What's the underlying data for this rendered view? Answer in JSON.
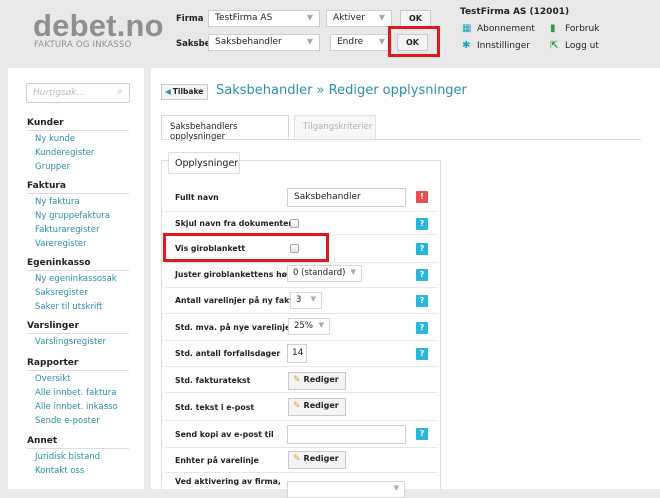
{
  "brand": {
    "name": "debet.no",
    "tagline": "FAKTURA OG INKASSO"
  },
  "topbar": {
    "firma_label": "Firma",
    "firma_value": "TestFirma AS",
    "firma_action": "Aktiver",
    "saksbeh_label": "Saksbeh.",
    "saksbeh_value": "Saksbehandler",
    "saksbeh_action": "Endre",
    "ok_label": "OK",
    "company": "TestFirma AS (12001)",
    "links": {
      "abonnement": "Abonnement",
      "forbruk": "Forbruk",
      "innstillinger": "Innstillinger",
      "loggut": "Logg ut"
    }
  },
  "sidebar": {
    "search_placeholder": "Hurtigsøk...",
    "sections": [
      {
        "title": "Kunder",
        "items": [
          "Ny kunde",
          "Kunderegister",
          "Grupper"
        ]
      },
      {
        "title": "Faktura",
        "items": [
          "Ny faktura",
          "Ny gruppefaktura",
          "Fakturaregister",
          "Vareregister"
        ]
      },
      {
        "title": "Egeninkasso",
        "items": [
          "Ny egeninkassosak",
          "Saksregister",
          "Saker til utskrift"
        ]
      },
      {
        "title": "Varslinger",
        "items": [
          "Varslingsregister"
        ]
      },
      {
        "title": "Rapporter",
        "items": [
          "Oversikt",
          "Alle innbet. faktura",
          "Alle innbet. inkasso",
          "Sende e-poster"
        ]
      },
      {
        "title": "Annet",
        "items": [
          "Juridisk bistand",
          "Kontakt oss"
        ]
      }
    ]
  },
  "main": {
    "back_label": "Tilbake",
    "title": "Saksbehandler » Rediger opplysninger",
    "tabs": [
      "Saksbehandlers opplysninger",
      "Tilgangskriterier"
    ],
    "legend": "Opplysninger",
    "fields": {
      "fullt_navn": {
        "label": "Fullt navn",
        "value": "Saksbehandler"
      },
      "skjul_navn": {
        "label": "Skjul navn fra dokumenter"
      },
      "vis_giro": {
        "label": "Vis giroblankett"
      },
      "juster_giro": {
        "label": "Juster giroblankettens høyde",
        "value": "0 (standard)"
      },
      "antall_varelinjer": {
        "label": "Antall varelinjer på ny faktura",
        "value": "3"
      },
      "std_mva": {
        "label": "Std. mva. på nye varelinjer",
        "value": "25%"
      },
      "forfallsdager": {
        "label": "Std. antall forfallsdager",
        "value": "14"
      },
      "fakturatekst": {
        "label": "Std. fakturatekst"
      },
      "epost_tekst": {
        "label": "Std. tekst i e-post"
      },
      "kopi_epost": {
        "label": "Send kopi av e-post til",
        "value": ""
      },
      "enhter": {
        "label": "Enhter på varelinje"
      },
      "aktivering": {
        "label": "Ved aktivering av firma,",
        "value": ""
      }
    },
    "edit_label": "Rediger",
    "help_glyph": "?",
    "alert_glyph": "!"
  },
  "colors": {
    "accent": "#2a8fb0",
    "help": "#29b6d8",
    "alert": "#e65050",
    "highlight": "#e0191c"
  }
}
